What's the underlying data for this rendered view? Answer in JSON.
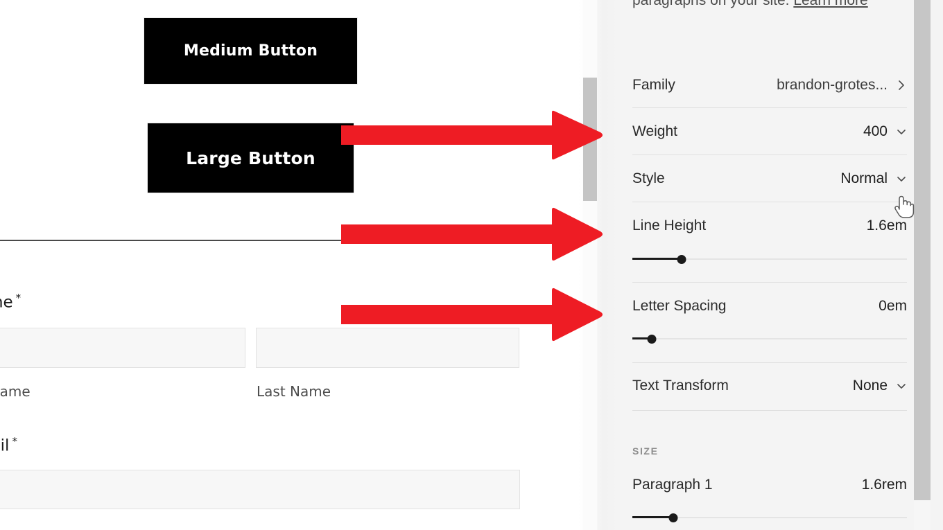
{
  "preview": {
    "buttons": [
      {
        "label": "Medium Button"
      },
      {
        "label": "Large Button"
      }
    ],
    "form": {
      "name_label": "ame",
      "name_required": "*",
      "first_name_sub": "st Name",
      "last_name_sub": "Last Name",
      "email_label": "nail",
      "email_required": "*"
    }
  },
  "panel": {
    "intro_text": "paragraphs on your site. ",
    "intro_link": "Learn more",
    "rows": [
      {
        "label": "Family",
        "value": "brandon-grotes...",
        "control": "chevron-right-icon"
      },
      {
        "label": "Weight",
        "value": "400",
        "control": "chevron-down-icon"
      },
      {
        "label": "Style",
        "value": "Normal",
        "control": "chevron-down-icon"
      },
      {
        "label": "Line Height",
        "value": "1.6em",
        "control": "slider"
      },
      {
        "label": "Letter Spacing",
        "value": "0em",
        "control": "slider"
      },
      {
        "label": "Text Transform",
        "value": "None",
        "control": "chevron-down-icon"
      }
    ],
    "sliders": {
      "line_height_pct": 18,
      "letter_spacing_pct": 7,
      "paragraph1_pct": 15
    },
    "size_section": {
      "title": "SIZE",
      "rows": [
        {
          "label": "Paragraph 1",
          "value": "1.6rem"
        }
      ]
    }
  },
  "annotations": {
    "arrow_color": "#ee1c24",
    "arrows": [
      {
        "name": "arrow-weight-row"
      },
      {
        "name": "arrow-line-height-row"
      },
      {
        "name": "arrow-letter-spacing-row"
      }
    ]
  },
  "cursor": {
    "type": "pointer-hand-cursor"
  }
}
